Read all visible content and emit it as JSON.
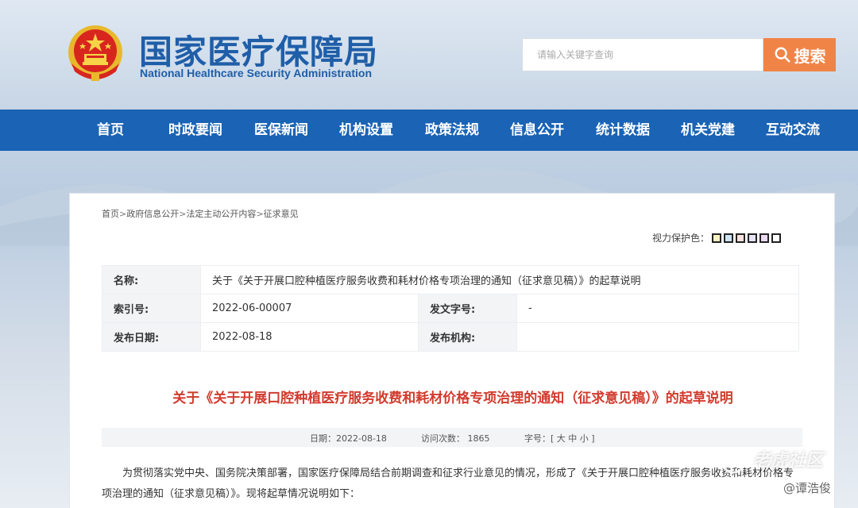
{
  "header": {
    "title_cn": "国家医疗保障局",
    "title_en": "National Healthcare Security Administration",
    "search_placeholder": "请输入关键字查询",
    "search_button": "搜索"
  },
  "nav": [
    "首页",
    "时政要闻",
    "医保新闻",
    "机构设置",
    "政策法规",
    "信息公开",
    "统计数据",
    "机关党建",
    "互动交流"
  ],
  "breadcrumb": [
    "首页",
    "政府信息公开",
    "法定主动公开内容",
    "征求意见"
  ],
  "vision": {
    "label": "视力保护色：",
    "colors": [
      "#f9f3c1",
      "#cde6f7",
      "#f9e1e1",
      "#e8e3f5",
      "#ecdaf3",
      "#ffffff"
    ]
  },
  "meta": {
    "name_label": "名称:",
    "name_value": "关于《关于开展口腔种植医疗服务收费和耗材价格专项治理的通知（征求意见稿）》的起草说明",
    "index_label": "索引号:",
    "index_value": "2022-06-00007",
    "docno_label": "发文字号:",
    "docno_value": "-",
    "date_label": "发布日期:",
    "date_value": "2022-08-18",
    "org_label": "发布机构:",
    "org_value": ""
  },
  "article": {
    "title": "关于《关于开展口腔种植医疗服务收费和耗材价格专项治理的通知（征求意见稿）》的起草说明",
    "date": "日期：2022-08-18",
    "visits": "访问次数：  1865",
    "fontsize_label": "字号：[",
    "fs_large": "大",
    "fs_medium": "中",
    "fs_small": "小",
    "fontsize_end": "]",
    "body": "为贯彻落实党中央、国务院决策部署，国家医疗保障局结合前期调查和征求行业意见的情况，形成了《关于开展口腔种植医疗服务收费和耗材价格专项治理的通知（征求意见稿）》。现将起草情况说明如下："
  },
  "watermark": {
    "main": "老虎社区",
    "sub": "@谭浩俊"
  }
}
